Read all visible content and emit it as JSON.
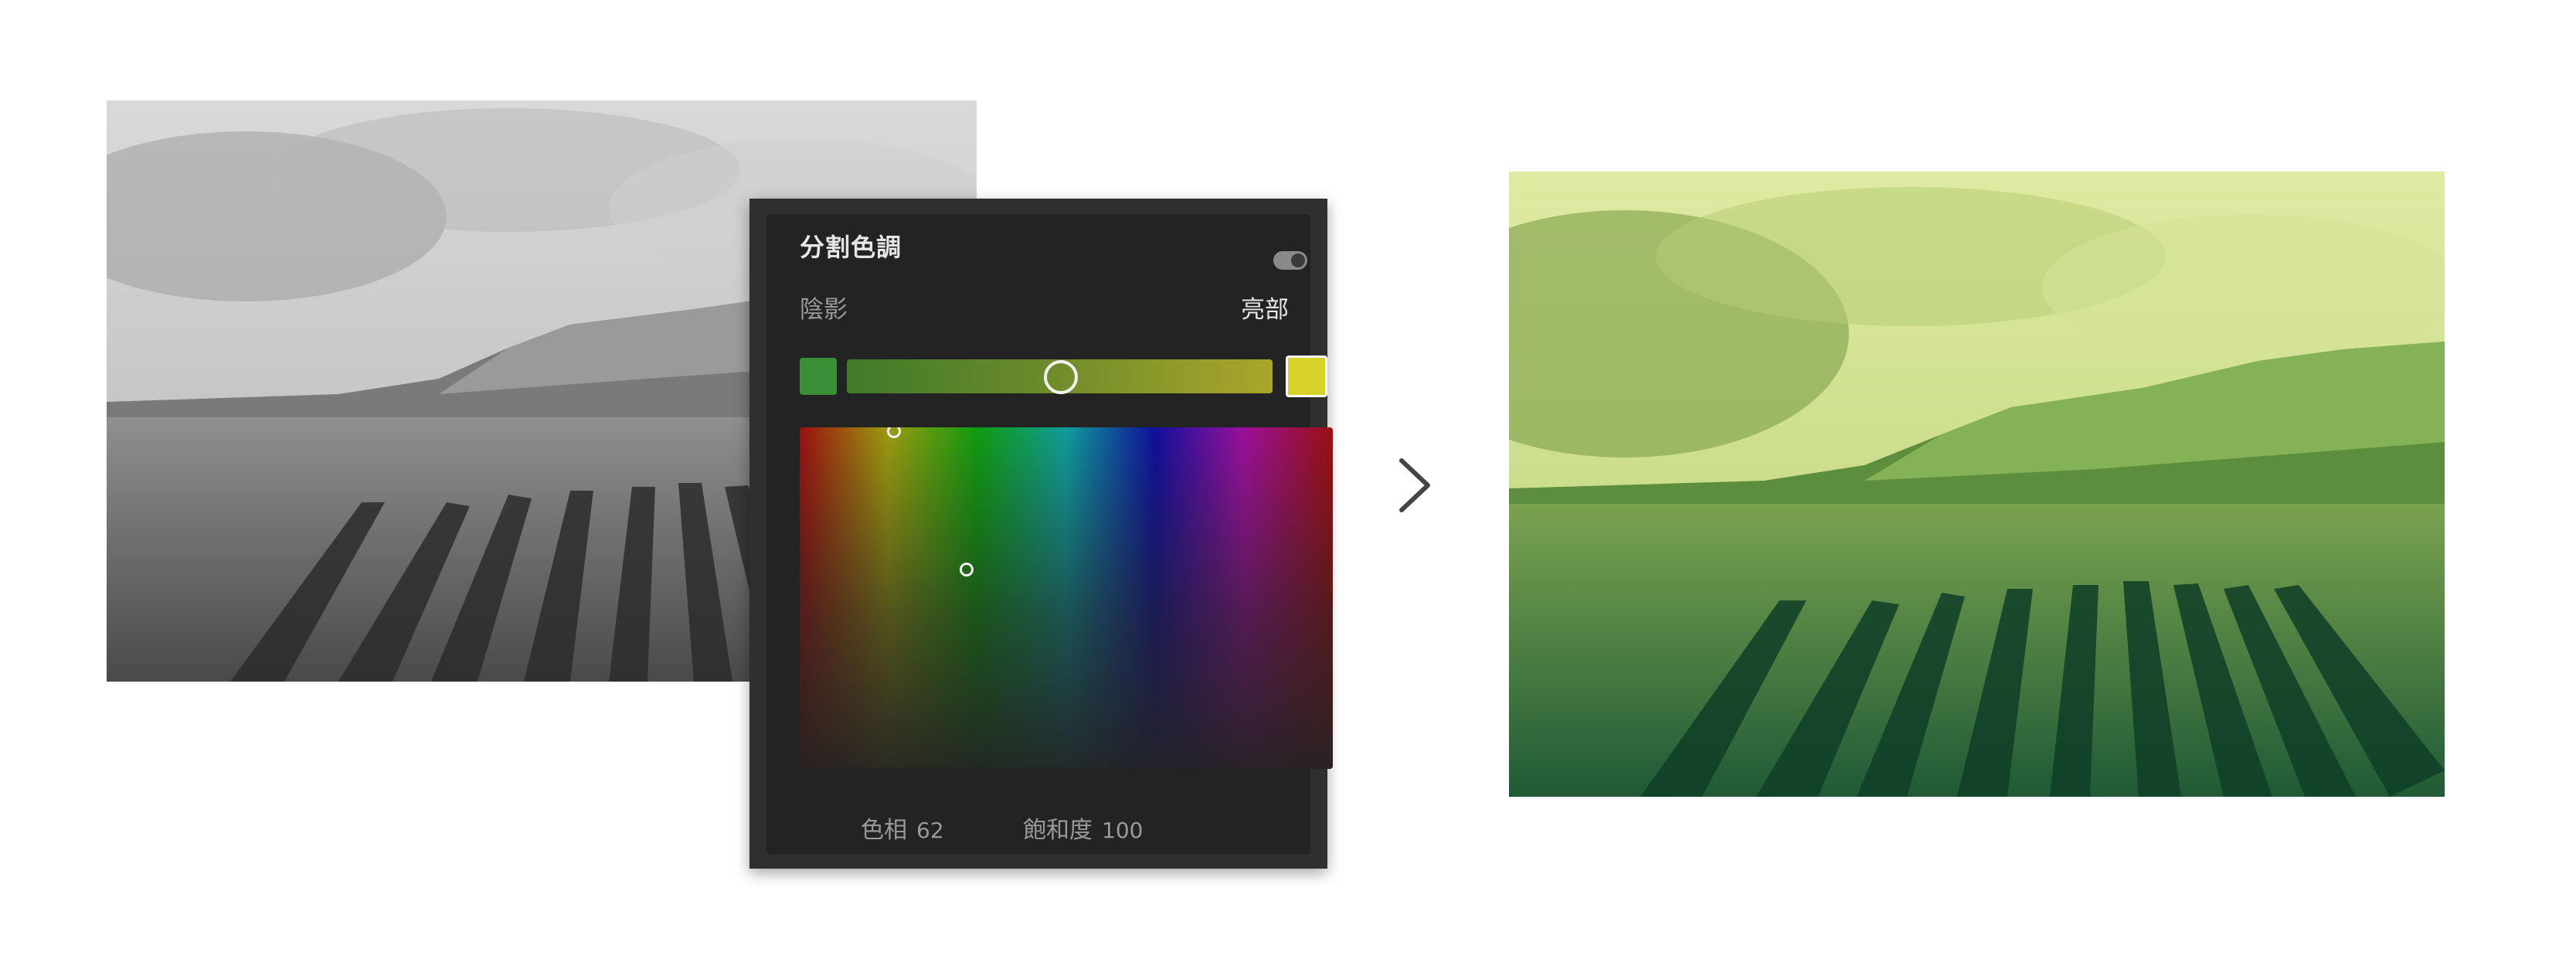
{
  "panel": {
    "title": "分割色調",
    "toggle_on": true,
    "shadow_label": "陰影",
    "highlight_label": "亮部",
    "shadow_color": "#3a8f36",
    "highlight_color": "#d8d229",
    "hue_label": "色相",
    "hue_value": "62",
    "saturation_label": "飽和度",
    "saturation_value": "100"
  },
  "arrow_icon": "chevron-right-icon",
  "colors": {
    "panel_bg": "#232323",
    "panel_frame": "#2f2f2f",
    "tint_green": "#2e6b3a",
    "tint_yellow": "#e8f0a8"
  }
}
